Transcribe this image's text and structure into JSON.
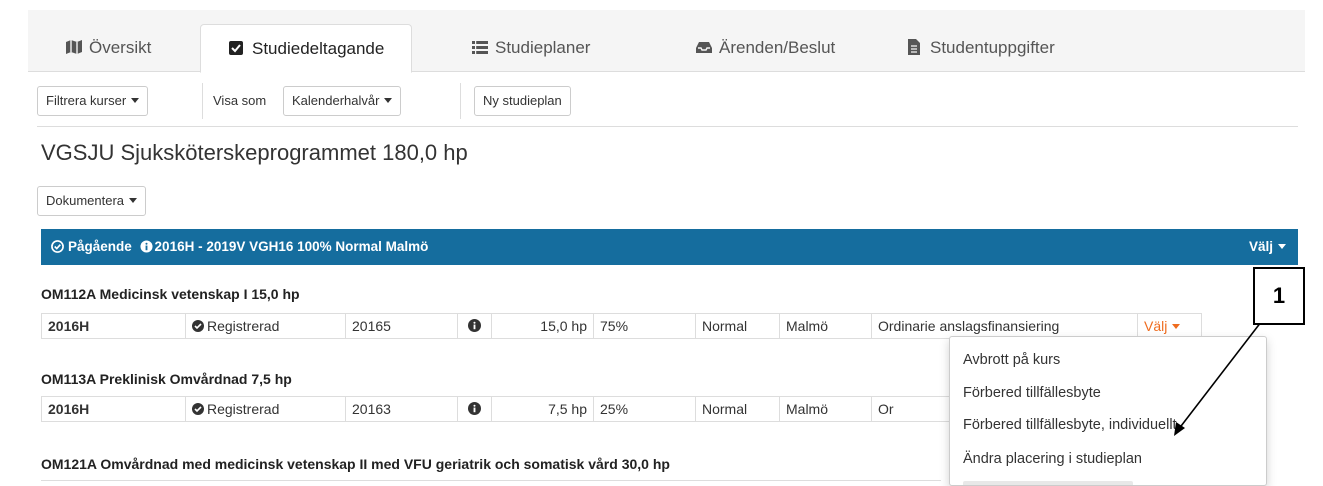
{
  "tabs": [
    {
      "label": "Översikt",
      "icon": "map-icon"
    },
    {
      "label": "Studiedeltagande",
      "icon": "checkbox-icon"
    },
    {
      "label": "Studieplaner",
      "icon": "list-icon"
    },
    {
      "label": "Ärenden/Beslut",
      "icon": "inbox-icon"
    },
    {
      "label": "Studentuppgifter",
      "icon": "document-icon"
    }
  ],
  "active_tab": "Studiedeltagande",
  "toolbar": {
    "filter_label": "Filtrera kurser",
    "view_as_label": "Visa som",
    "view_select": "Kalenderhalvår",
    "new_plan_label": "Ny studieplan"
  },
  "program": {
    "title": "VGSJU Sjuksköterskeprogrammet 180,0 hp",
    "document_label": "Dokumentera"
  },
  "period_bar": {
    "status": "Pågående",
    "info": "2016H - 2019V VGH16 100% Normal Malmö",
    "choose_label": "Välj",
    "color": "#156d9e"
  },
  "courses": [
    {
      "title": "OM112A Medicinsk vetenskap I 15,0 hp",
      "row": {
        "term": "2016H",
        "status": "Registrerad",
        "code": "20165",
        "credits": "15,0 hp",
        "pace": "75%",
        "type": "Normal",
        "location": "Malmö",
        "funding": "Ordinarie anslagsfinansiering",
        "action": "Välj"
      }
    },
    {
      "title": "OM113A Preklinisk Omvårdnad 7,5 hp",
      "row": {
        "term": "2016H",
        "status": "Registrerad",
        "code": "20163",
        "credits": "7,5 hp",
        "pace": "25%",
        "type": "Normal",
        "location": "Malmö",
        "funding": "Or"
      }
    },
    {
      "title": "OM121A Omvårdnad med medicinsk vetenskap II med VFU geriatrik och somatisk vård 30,0 hp"
    }
  ],
  "dropdown_menu": {
    "items": [
      "Avbrott på kurs",
      "Förbered tillfällesbyte",
      "Förbered tillfällesbyte, individuellt",
      "Ändra placering i studieplan"
    ]
  },
  "annotation": {
    "label": "1"
  },
  "colors": {
    "accent_orange": "#ef6c1f",
    "header_blue": "#156d9e"
  }
}
